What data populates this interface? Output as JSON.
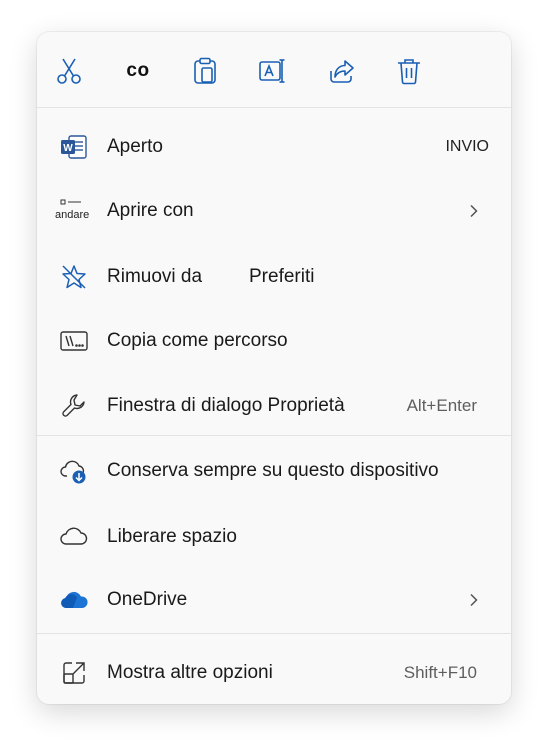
{
  "toolbar": {
    "cut": "cut-icon",
    "copy_label": "co",
    "paste": "paste-icon",
    "rename": "rename-icon",
    "share": "share-icon",
    "delete": "trash-icon"
  },
  "items": [
    {
      "label": "Aperto",
      "shortcut": "INVIO",
      "icon": "word-icon"
    },
    {
      "label": "Aprire con",
      "icon_text": "andare",
      "icon": "open-with-icon"
    },
    {
      "label": "Rimuovi da",
      "label2": "Preferiti",
      "icon": "unstar-icon"
    },
    {
      "label": "Copia come percorso",
      "icon": "path-icon"
    },
    {
      "label": "Finestra di dialogo Proprietà",
      "shortcut": "Alt+Enter",
      "icon": "wrench-icon"
    },
    {
      "label": "Conserva sempre su questo dispositivo",
      "icon": "cloud-download-icon"
    },
    {
      "label": "Liberare spazio",
      "icon": "cloud-icon"
    },
    {
      "label": "OneDrive",
      "icon": "onedrive-icon"
    },
    {
      "label": "Mostra altre opzioni",
      "shortcut": "Shift+F10",
      "icon": "expand-icon"
    }
  ],
  "colors": {
    "accent": "#1a5fb4",
    "word": "#2b579a",
    "onedrive": "#1c74d4"
  }
}
